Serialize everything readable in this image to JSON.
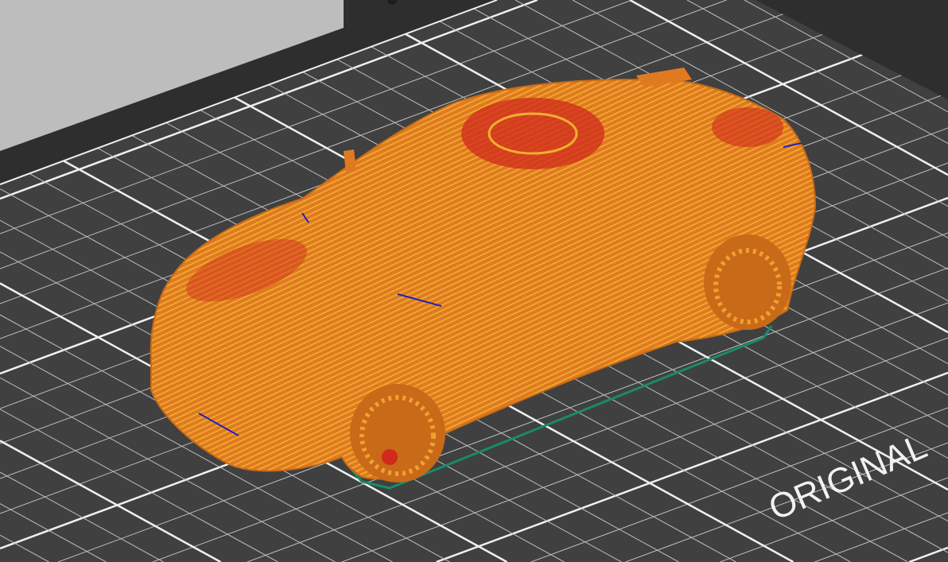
{
  "viewport": {
    "bed_label": "ORIGINAL"
  },
  "colors": {
    "background_light": "#bdbdbd",
    "frame_dark": "#2e2e2e",
    "bed": "#3f3f3f",
    "grid": "#d8d8d8",
    "model_orange": "#e07a20",
    "model_yellow": "#f0b030",
    "model_red": "#d02a1c",
    "skirt": "#1a8a6a"
  }
}
